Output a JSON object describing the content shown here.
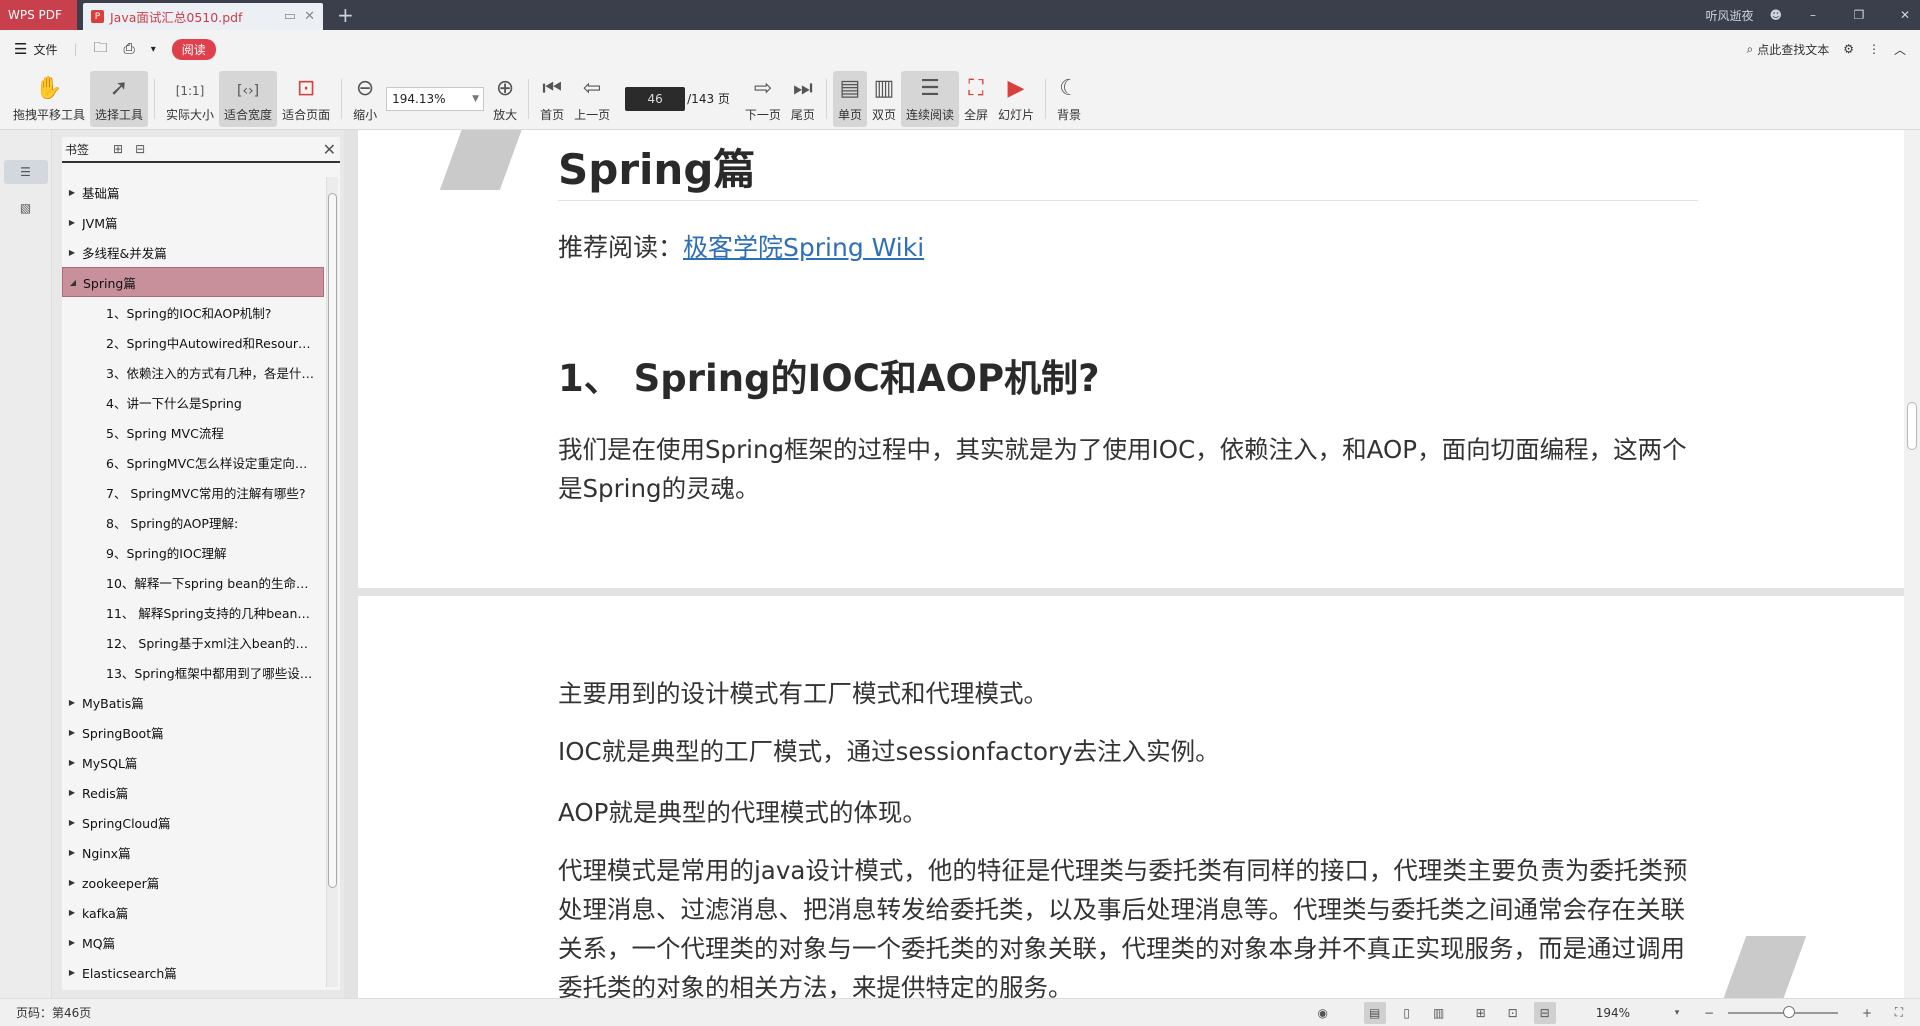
{
  "titlebar": {
    "app_name": "WPS PDF",
    "tab_title": "Java面试汇总0510.pdf",
    "user_name": "听风逝夜"
  },
  "menubar": {
    "file_label": "文件",
    "read_label": "阅读",
    "search_label": "点此查找文本"
  },
  "toolbar": {
    "pan_label": "拖拽平移工具",
    "select_label": "选择工具",
    "actual_size_label": "实际大小",
    "fit_width_label": "适合宽度",
    "fit_page_label": "适合页面",
    "zoom_out_label": "缩小",
    "zoom_value": "194.13%",
    "zoom_in_label": "放大",
    "first_label": "首页",
    "prev_label": "上一页",
    "page_current": "46",
    "page_total": "/143 页",
    "next_label": "下一页",
    "last_label": "尾页",
    "single_label": "单页",
    "double_label": "双页",
    "continuous_label": "连续阅读",
    "fullscreen_label": "全屏",
    "slides_label": "幻灯片",
    "background_label": "背景"
  },
  "bookmarks": {
    "title": "书签",
    "items": [
      {
        "label": "基础篇",
        "level": 0,
        "expanded": false
      },
      {
        "label": "JVM篇",
        "level": 0,
        "expanded": false
      },
      {
        "label": "多线程&并发篇",
        "level": 0,
        "expanded": false
      },
      {
        "label": "Spring篇",
        "level": 0,
        "expanded": true
      },
      {
        "label": "1、Spring的IOC和AOP机制?",
        "level": 1
      },
      {
        "label": "2、Spring中Autowired和Resour…",
        "level": 1
      },
      {
        "label": "3、依赖注入的方式有几种，各是什…",
        "level": 1
      },
      {
        "label": "4、讲一下什么是Spring",
        "level": 1
      },
      {
        "label": "5、Spring MVC流程",
        "level": 1
      },
      {
        "label": "6、SpringMVC怎么样设定重定向…",
        "level": 1
      },
      {
        "label": "7、 SpringMVC常用的注解有哪些?",
        "level": 1
      },
      {
        "label": "8、 Spring的AOP理解:",
        "level": 1
      },
      {
        "label": "9、Spring的IOC理解",
        "level": 1
      },
      {
        "label": "10、解释一下spring bean的生命…",
        "level": 1
      },
      {
        "label": "11、 解释Spring支持的几种bean…",
        "level": 1
      },
      {
        "label": "12、 Spring基于xml注入bean的…",
        "level": 1
      },
      {
        "label": "13、Spring框架中都用到了哪些设…",
        "level": 1
      },
      {
        "label": "MyBatis篇",
        "level": 0,
        "expanded": false
      },
      {
        "label": "SpringBoot篇",
        "level": 0,
        "expanded": false
      },
      {
        "label": "MySQL篇",
        "level": 0,
        "expanded": false
      },
      {
        "label": "Redis篇",
        "level": 0,
        "expanded": false
      },
      {
        "label": "SpringCloud篇",
        "level": 0,
        "expanded": false
      },
      {
        "label": "Nginx篇",
        "level": 0,
        "expanded": false
      },
      {
        "label": "zookeeper篇",
        "level": 0,
        "expanded": false
      },
      {
        "label": "kafka篇",
        "level": 0,
        "expanded": false
      },
      {
        "label": "MQ篇",
        "level": 0,
        "expanded": false
      },
      {
        "label": "Elasticsearch篇",
        "level": 0,
        "expanded": false
      }
    ]
  },
  "document": {
    "page1": {
      "heading": "Spring篇",
      "recommend_prefix": "推荐阅读：",
      "recommend_link": "极客学院Spring Wiki",
      "section_title": "1、 Spring的IOC和AOP机制?",
      "paragraph": "我们是在使用Spring框架的过程中，其实就是为了使用IOC，依赖注入，和AOP，面向切面编程，这两个是Spring的灵魂。"
    },
    "page2": {
      "p1": "主要用到的设计模式有工厂模式和代理模式。",
      "p2": "IOC就是典型的工厂模式，通过sessionfactory去注入实例。",
      "p3": "AOP就是典型的代理模式的体现。",
      "p4": "代理模式是常用的java设计模式，他的特征是代理类与委托类有同样的接口，代理类主要负责为委托类预处理消息、过滤消息、把消息转发给委托类，以及事后处理消息等。代理类与委托类之间通常会存在关联关系，一个代理类的对象与一个委托类的对象关联，代理类的对象本身并不真正实现服务，而是通过调用委托类的对象的相关方法，来提供特定的服务。"
    }
  },
  "statusbar": {
    "page_info": "页码：第46页",
    "zoom_percent": "194%",
    "zoom_fraction": 0.55
  }
}
